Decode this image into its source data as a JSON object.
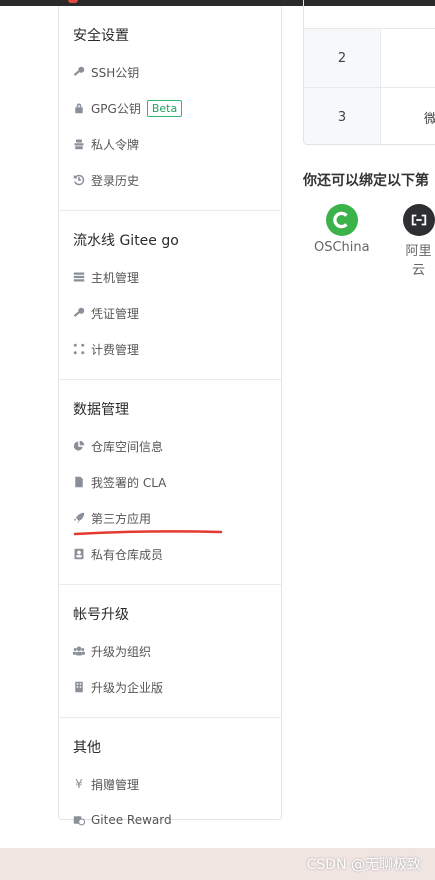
{
  "sidebar": {
    "sections": [
      {
        "title": "安全设置",
        "items": [
          {
            "label": "SSH公钥",
            "icon": "key-icon"
          },
          {
            "label": "GPG公钥",
            "icon": "lock-icon",
            "badge": "Beta"
          },
          {
            "label": "私人令牌",
            "icon": "token-icon"
          },
          {
            "label": "登录历史",
            "icon": "history-icon"
          }
        ]
      },
      {
        "title": "流水线 Gitee go",
        "items": [
          {
            "label": "主机管理",
            "icon": "server-icon"
          },
          {
            "label": "凭证管理",
            "icon": "key-icon"
          },
          {
            "label": "计费管理",
            "icon": "nodes-icon"
          }
        ]
      },
      {
        "title": "数据管理",
        "items": [
          {
            "label": "仓库空间信息",
            "icon": "pie-icon"
          },
          {
            "label": "我签署的 CLA",
            "icon": "file-icon"
          },
          {
            "label": "第三方应用",
            "icon": "rocket-icon"
          },
          {
            "label": "私有仓库成员",
            "icon": "contact-icon"
          }
        ]
      },
      {
        "title": "帐号升级",
        "items": [
          {
            "label": "升级为组织",
            "icon": "users-icon"
          },
          {
            "label": "升级为企业版",
            "icon": "building-icon"
          }
        ]
      },
      {
        "title": "其他",
        "items": [
          {
            "label": "捐赠管理",
            "icon": "yen-icon"
          },
          {
            "label": "Gitee Reward",
            "icon": "reward-icon"
          }
        ]
      }
    ]
  },
  "table": {
    "rows": [
      {
        "num": "2",
        "text": ""
      },
      {
        "num": "3",
        "text": "微"
      }
    ]
  },
  "bind": {
    "title": "你还可以绑定以下第",
    "apps": [
      {
        "name": "OSChina",
        "color": "#3cb34a"
      },
      {
        "name": "阿里云",
        "color": "#2d2f33"
      }
    ]
  },
  "watermark": "CSDN @无聊极致",
  "colors": {
    "accent_badge": "#21a060",
    "underline": "#e23a2e"
  }
}
